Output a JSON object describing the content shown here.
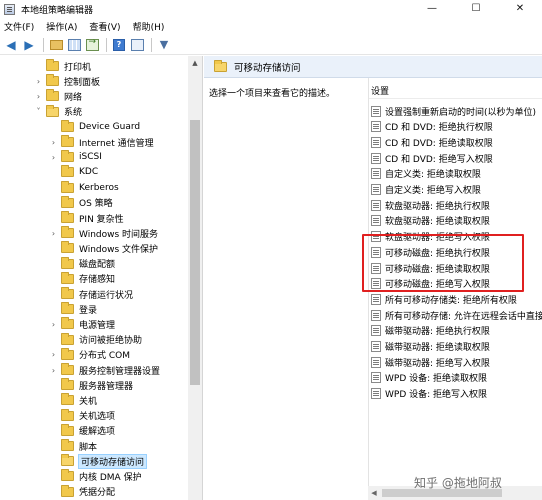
{
  "window": {
    "title": "本地组策略编辑器",
    "controls": [
      "—",
      "☐",
      "✕"
    ]
  },
  "menu": [
    "文件(F)",
    "操作(A)",
    "查看(V)",
    "帮助(H)"
  ],
  "toolbar": {
    "icons": [
      "back-arrow-icon",
      "forward-arrow-icon",
      "up-folder-icon",
      "show-hide-tree-icon",
      "export-list-icon",
      "help-icon",
      "view-icon",
      "filter-icon"
    ]
  },
  "tree": {
    "items": [
      {
        "label": "打印机",
        "level": 2,
        "expander": "",
        "selected": false
      },
      {
        "label": "控制面板",
        "level": 2,
        "expander": "›",
        "selected": false
      },
      {
        "label": "网络",
        "level": 2,
        "expander": "›",
        "selected": false
      },
      {
        "label": "系统",
        "level": 2,
        "expander": "˅",
        "selected": false
      },
      {
        "label": "Device Guard",
        "level": 3,
        "expander": "",
        "selected": false
      },
      {
        "label": "Internet 通信管理",
        "level": 3,
        "expander": "›",
        "selected": false
      },
      {
        "label": "iSCSI",
        "level": 3,
        "expander": "›",
        "selected": false
      },
      {
        "label": "KDC",
        "level": 3,
        "expander": "",
        "selected": false
      },
      {
        "label": "Kerberos",
        "level": 3,
        "expander": "",
        "selected": false
      },
      {
        "label": "OS 策略",
        "level": 3,
        "expander": "",
        "selected": false
      },
      {
        "label": "PIN 复杂性",
        "level": 3,
        "expander": "",
        "selected": false
      },
      {
        "label": "Windows 时间服务",
        "level": 3,
        "expander": "›",
        "selected": false
      },
      {
        "label": "Windows 文件保护",
        "level": 3,
        "expander": "",
        "selected": false
      },
      {
        "label": "磁盘配额",
        "level": 3,
        "expander": "",
        "selected": false
      },
      {
        "label": "存储感知",
        "level": 3,
        "expander": "",
        "selected": false
      },
      {
        "label": "存储运行状况",
        "level": 3,
        "expander": "",
        "selected": false
      },
      {
        "label": "登录",
        "level": 3,
        "expander": "",
        "selected": false
      },
      {
        "label": "电源管理",
        "level": 3,
        "expander": "›",
        "selected": false
      },
      {
        "label": "访问被拒绝协助",
        "level": 3,
        "expander": "",
        "selected": false
      },
      {
        "label": "分布式 COM",
        "level": 3,
        "expander": "›",
        "selected": false
      },
      {
        "label": "服务控制管理器设置",
        "level": 3,
        "expander": "›",
        "selected": false
      },
      {
        "label": "服务器管理器",
        "level": 3,
        "expander": "",
        "selected": false
      },
      {
        "label": "关机",
        "level": 3,
        "expander": "",
        "selected": false
      },
      {
        "label": "关机选项",
        "level": 3,
        "expander": "",
        "selected": false
      },
      {
        "label": "缓解选项",
        "level": 3,
        "expander": "",
        "selected": false
      },
      {
        "label": "脚本",
        "level": 3,
        "expander": "",
        "selected": false
      },
      {
        "label": "可移动存储访问",
        "level": 3,
        "expander": "",
        "selected": true
      },
      {
        "label": "内核 DMA 保护",
        "level": 3,
        "expander": "",
        "selected": false
      },
      {
        "label": "凭据分配",
        "level": 3,
        "expander": "",
        "selected": false
      }
    ]
  },
  "right_pane": {
    "header": "可移动存储访问",
    "description": "选择一个项目来查看它的描述。",
    "column_header": "设置",
    "settings": [
      "设置强制重新启动的时间(以秒为单位)",
      "CD 和 DVD: 拒绝执行权限",
      "CD 和 DVD: 拒绝读取权限",
      "CD 和 DVD: 拒绝写入权限",
      "自定义类: 拒绝读取权限",
      "自定义类: 拒绝写入权限",
      "软盘驱动器: 拒绝执行权限",
      "软盘驱动器: 拒绝读取权限",
      "软盘驱动器: 拒绝写入权限",
      "可移动磁盘: 拒绝执行权限",
      "可移动磁盘: 拒绝读取权限",
      "可移动磁盘: 拒绝写入权限",
      "所有可移动存储类: 拒绝所有权限",
      "所有可移动存储: 允许在远程会话中直接",
      "磁带驱动器: 拒绝执行权限",
      "磁带驱动器: 拒绝读取权限",
      "磁带驱动器: 拒绝写入权限",
      "WPD 设备: 拒绝读取权限",
      "WPD 设备: 拒绝写入权限"
    ]
  },
  "watermark": "知乎 @拖地阿叔",
  "colors": {
    "highlight_box": "#e02020",
    "selection": "#cce8ff",
    "folder": "#f1c84b"
  }
}
